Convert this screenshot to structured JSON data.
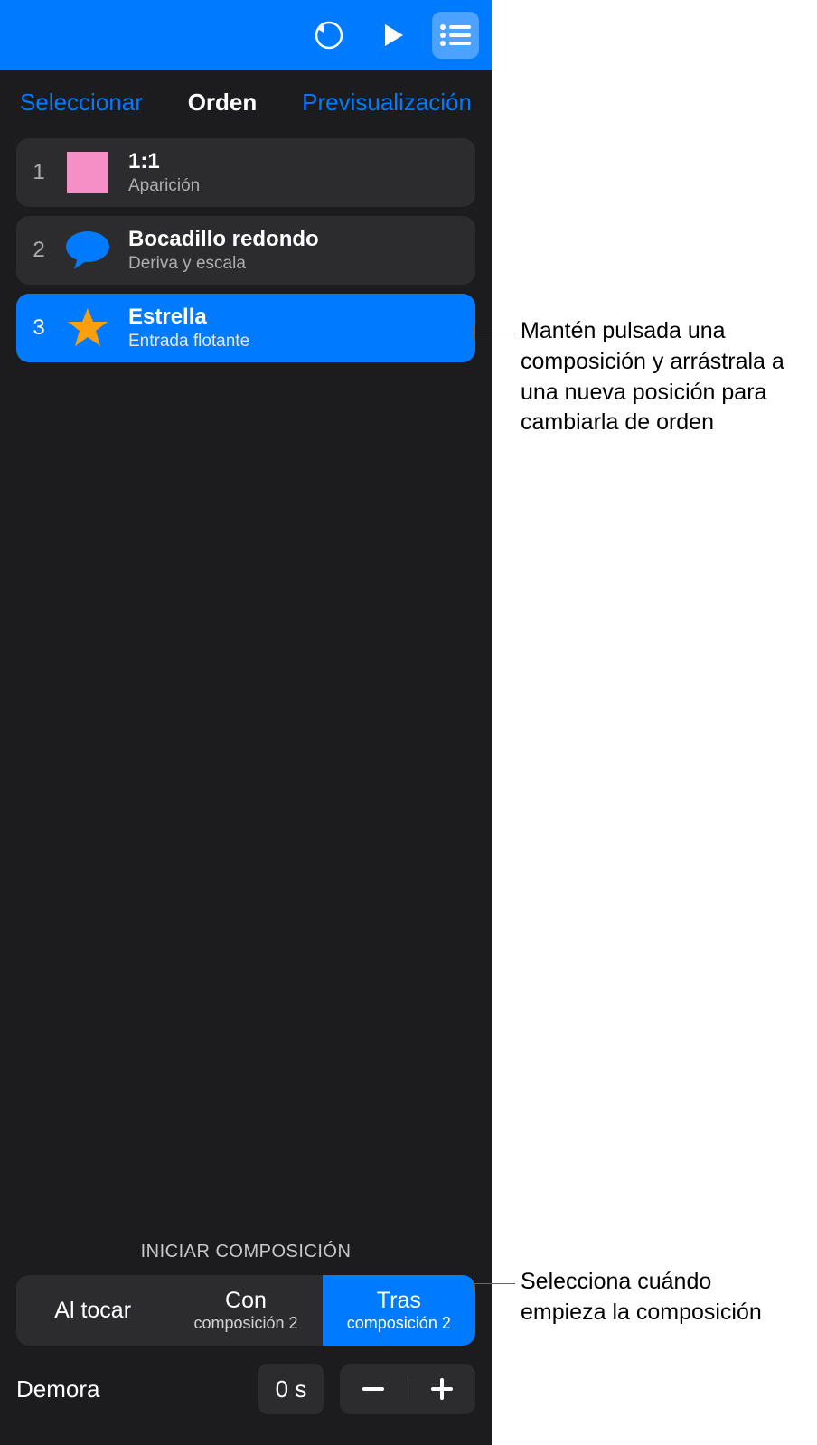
{
  "tabs": {
    "select": "Seleccionar",
    "order": "Orden",
    "preview": "Previsualización"
  },
  "list": [
    {
      "num": "1",
      "title": "1:1",
      "subtitle": "Aparición",
      "icon": "square",
      "selected": false
    },
    {
      "num": "2",
      "title": "Bocadillo redondo",
      "subtitle": "Deriva y escala",
      "icon": "speech",
      "selected": false
    },
    {
      "num": "3",
      "title": "Estrella",
      "subtitle": "Entrada flotante",
      "icon": "star",
      "selected": true
    }
  ],
  "bottom": {
    "section_title": "INICIAR COMPOSICIÓN",
    "segments": [
      {
        "title": "Al tocar",
        "sub": "",
        "active": false
      },
      {
        "title": "Con",
        "sub": "composición 2",
        "active": false
      },
      {
        "title": "Tras",
        "sub": "composición 2",
        "active": true
      }
    ],
    "delay_label": "Demora",
    "delay_value": "0 s"
  },
  "callouts": {
    "top": "Mantén pulsada una composición y arrástrala a una nueva posición para cambiarla de orden",
    "bottom": "Selecciona cuándo empieza la composición"
  },
  "colors": {
    "accent": "#007aff",
    "pink": "#f78fc7",
    "speech": "#007aff",
    "star": "#ff9f0a"
  }
}
